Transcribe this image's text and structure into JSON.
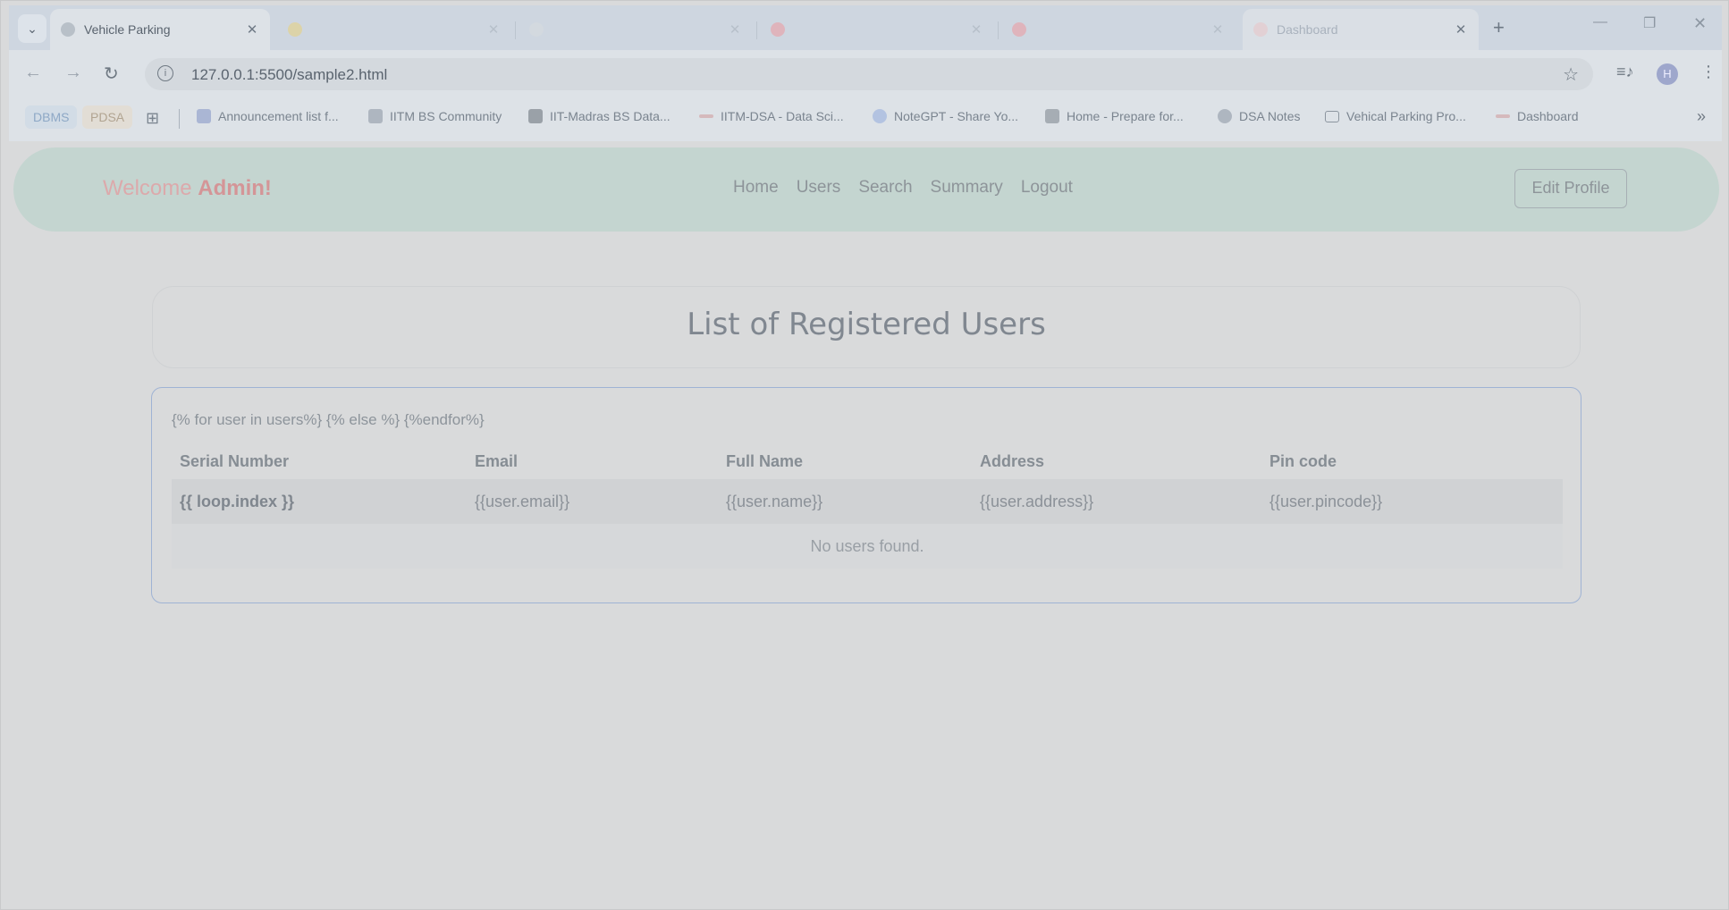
{
  "browser": {
    "tabs": [
      {
        "title": "Vehicle Parking",
        "active": true
      },
      {
        "title": "",
        "active": false
      },
      {
        "title": "",
        "active": false
      },
      {
        "title": "",
        "active": false
      },
      {
        "title": "",
        "active": false
      },
      {
        "title": "Dashboard",
        "active": false
      }
    ],
    "url": "127.0.0.1:5500/sample2.html",
    "profile_initial": "H",
    "bookmarks": {
      "chip1": "DBMS",
      "chip2": "PDSA",
      "items": [
        "Announcement list f...",
        "IITM BS Community",
        "IIT-Madras BS Data...",
        "IITM-DSA - Data Sci...",
        "NoteGPT - Share Yo...",
        "Home - Prepare for...",
        "DSA Notes",
        "Vehical Parking Pro...",
        "Dashboard"
      ]
    }
  },
  "page": {
    "welcome_prefix": "Welcome ",
    "welcome_name": "Admin!",
    "nav": [
      "Home",
      "Users",
      "Search",
      "Summary",
      "Logout"
    ],
    "edit_profile": "Edit Profile",
    "heading": "List of Registered Users",
    "template_text": "{% for user in users%} {% else %} {%endfor%}",
    "table": {
      "headers": [
        "Serial Number",
        "Email",
        "Full Name",
        "Address",
        "Pin code"
      ],
      "row": [
        "{{ loop.index }}",
        "{{user.email}}",
        "{{user.name}}",
        "{{user.address}}",
        "{{user.pincode}}"
      ]
    },
    "empty_message": "No users found."
  },
  "colors": {
    "navbar_bg": "#c4d5d0",
    "welcome": "#dca9ab",
    "card_border": "#9fb3d4"
  },
  "icons": [
    "tab-search-icon",
    "close-icon",
    "new-tab-icon",
    "back-icon",
    "forward-icon",
    "reload-icon",
    "info-icon",
    "star-icon",
    "media-icon",
    "menu-icon",
    "apps-icon",
    "bookmarks-more-icon"
  ]
}
